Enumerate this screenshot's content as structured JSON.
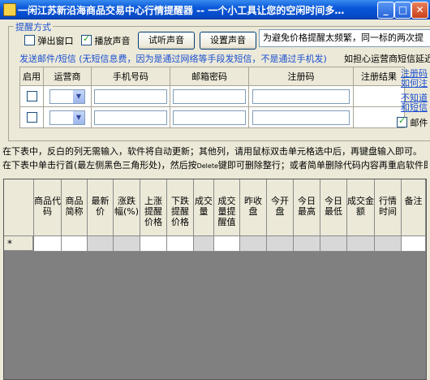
{
  "window": {
    "title": "一闲江苏新沿海商品交易中心行情提醒器  --   一个小工具让您的空闲时间多…",
    "minimize_glyph": "_",
    "maximize_glyph": "□",
    "close_glyph": "✕"
  },
  "alert_group": {
    "legend": "提醒方式",
    "popup_label": "弹出窗口",
    "popup_checked": false,
    "sound_label": "播放声音",
    "sound_checked": true,
    "test_sound_button": "试听声音",
    "set_sound_button": "设置声音",
    "note": "为避免价格提醒太频繁，同一标的两次提醒间"
  },
  "sms": {
    "heading": "发送邮件/短信 (无短信息费，因为是通过网络等手段发短信，不是通过手机发)",
    "worry_note": "如担心运营商短信延迟",
    "columns": [
      "启用",
      "运营商",
      "手机号码",
      "邮箱密码",
      "注册码",
      "注册结果"
    ],
    "rows": [
      {
        "enabled": false,
        "carrier": "",
        "phone": "",
        "password": "",
        "reg_code": "",
        "result": ""
      },
      {
        "enabled": false,
        "carrier": "",
        "phone": "",
        "password": "",
        "reg_code": "",
        "result": ""
      }
    ],
    "links": [
      "注册码",
      "如何注",
      "不知道",
      "和短信"
    ],
    "mail_label": "邮件",
    "mail_checked": true
  },
  "instructions": {
    "line1": "在下表中，反白的列无需输入，软件将自动更新；其他列，请用鼠标双击单元格选中后，再键盘输入即可。",
    "line2_a": "在下表中单击行首(最左侧黑色三角形处)，然后按",
    "line2_key": "Delete",
    "line2_b": "键即可删除整行；或者简单删除代码内容再重启软件即可"
  },
  "grid": {
    "columns": [
      "商品代码",
      "商品简称",
      "最新价",
      "涨跌幅(%)",
      "上涨提醒价格",
      "下跌提醒价格",
      "成交量",
      "成交量提醒值",
      "昨收盘",
      "今开盘",
      "今日最高",
      "今日最低",
      "成交金额",
      "行情时间",
      "备注"
    ],
    "new_row_marker": "*"
  }
}
